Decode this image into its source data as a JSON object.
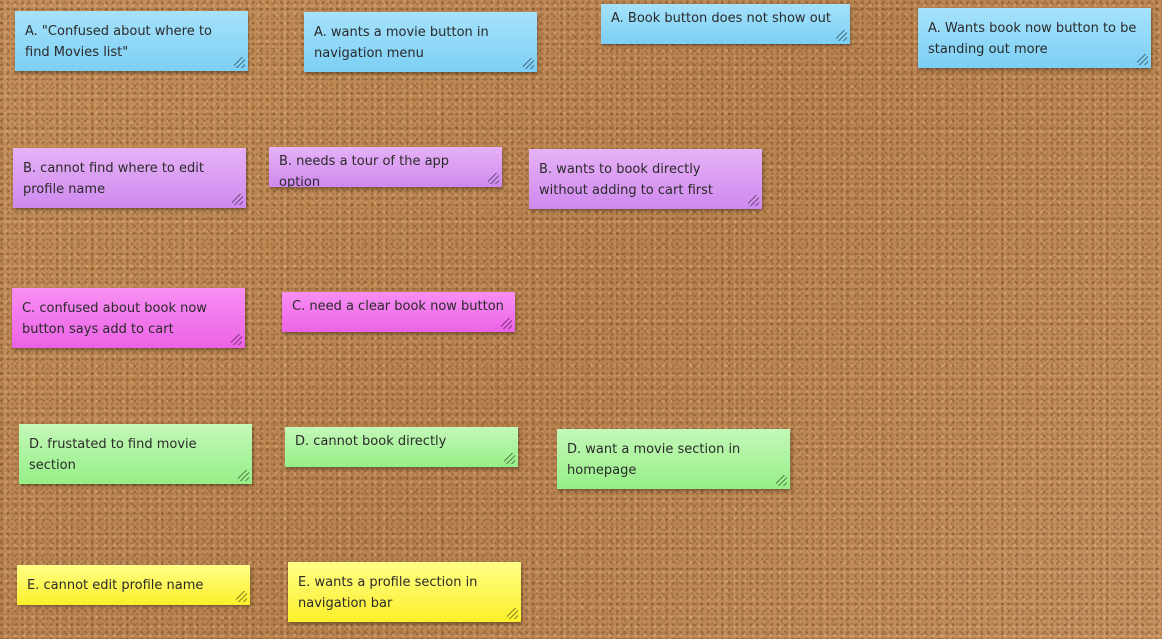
{
  "board": {
    "colors": {
      "blue": "#8fd9f8",
      "purple": "#dba0f3",
      "pink": "#f276ec",
      "green": "#aef4a0",
      "yellow": "#fdf64e",
      "cork": "#c08a55"
    },
    "notes": {
      "a1": "A. \"Confused about where to find Movies list\"",
      "a2": "A. wants a movie button in navigation menu",
      "a3": "A. Book button does not show out",
      "a4": "A. Wants book now button to be standing out more",
      "b1": "B. cannot find where to edit profile name",
      "b2": "B. needs a tour of the app option",
      "b3": "B. wants to book directly without adding to cart first",
      "c1": "C. confused about book now button says add to cart",
      "c2": "C. need a clear book now button",
      "d1": "D. frustated to find movie section",
      "d2": "D. cannot book directly",
      "d3": "D. want a movie section in homepage",
      "e1": "E. cannot edit profile name",
      "e2": "E. wants a profile section in navigation bar"
    }
  }
}
